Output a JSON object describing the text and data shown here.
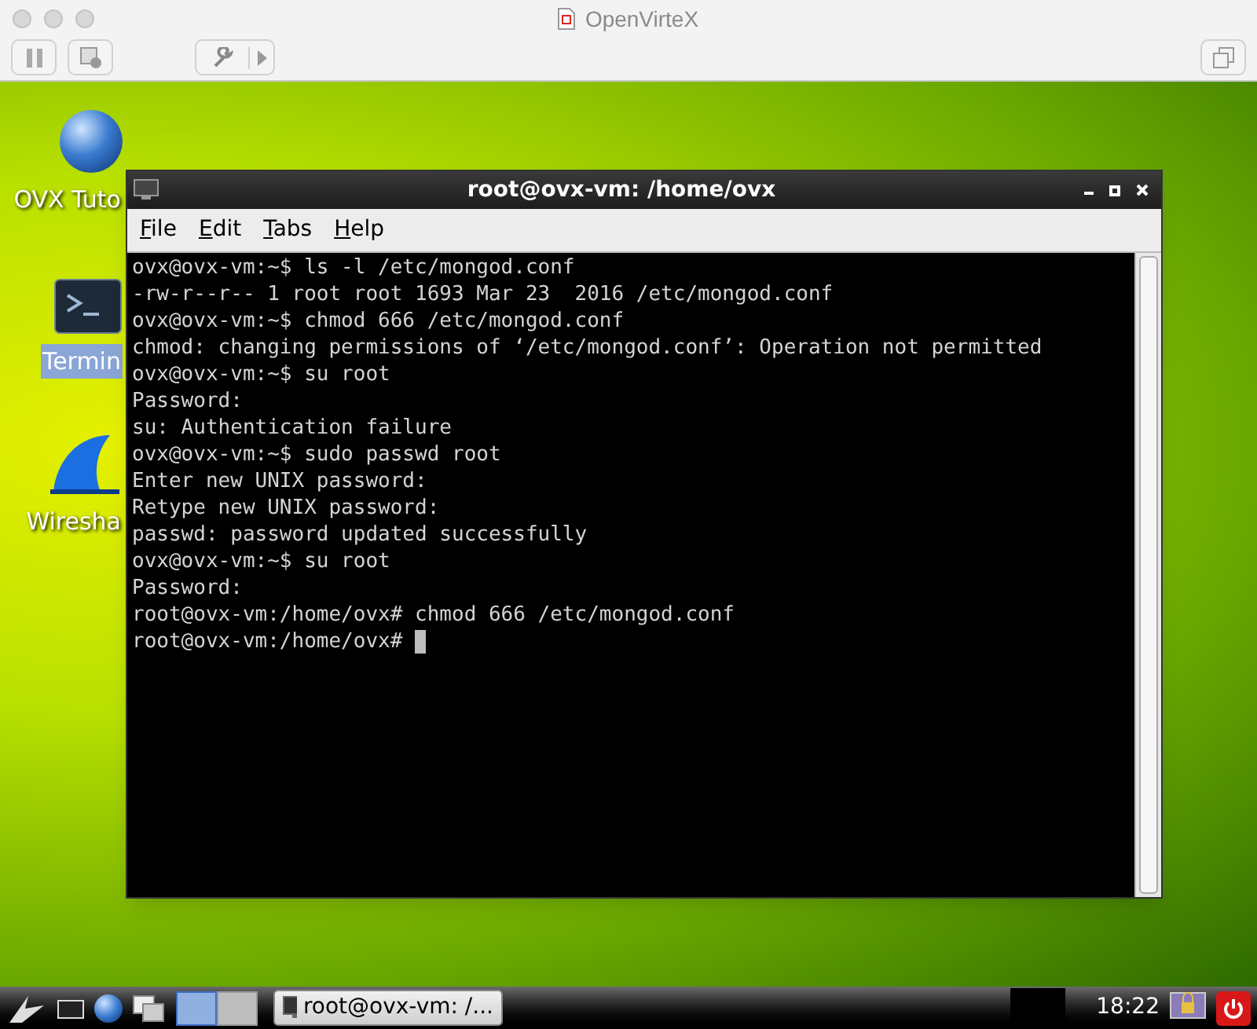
{
  "window": {
    "title": "OpenVirteX"
  },
  "desktop_icons": [
    {
      "kind": "globe",
      "label": "OVX Tuto",
      "selected": false
    },
    {
      "kind": "terminal",
      "label": "Termin",
      "selected": true
    },
    {
      "kind": "fin",
      "label": "Wiresha",
      "selected": false
    }
  ],
  "terminal": {
    "title": "root@ovx-vm: /home/ovx",
    "menu": [
      "File",
      "Edit",
      "Tabs",
      "Help"
    ],
    "lines": [
      "ovx@ovx-vm:~$ ls -l /etc/mongod.conf",
      "-rw-r--r-- 1 root root 1693 Mar 23  2016 /etc/mongod.conf",
      "ovx@ovx-vm:~$ chmod 666 /etc/mongod.conf",
      "chmod: changing permissions of ‘/etc/mongod.conf’: Operation not permitted",
      "ovx@ovx-vm:~$ su root",
      "Password:",
      "su: Authentication failure",
      "ovx@ovx-vm:~$ sudo passwd root",
      "Enter new UNIX password:",
      "Retype new UNIX password:",
      "passwd: password updated successfully",
      "ovx@ovx-vm:~$ su root",
      "Password:",
      "root@ovx-vm:/home/ovx# chmod 666 /etc/mongod.conf",
      "root@ovx-vm:/home/ovx# "
    ]
  },
  "taskbar": {
    "pager": [
      {
        "selected": true
      },
      {
        "selected": false
      }
    ],
    "task": "root@ovx-vm: /...",
    "clock": "18:22"
  }
}
